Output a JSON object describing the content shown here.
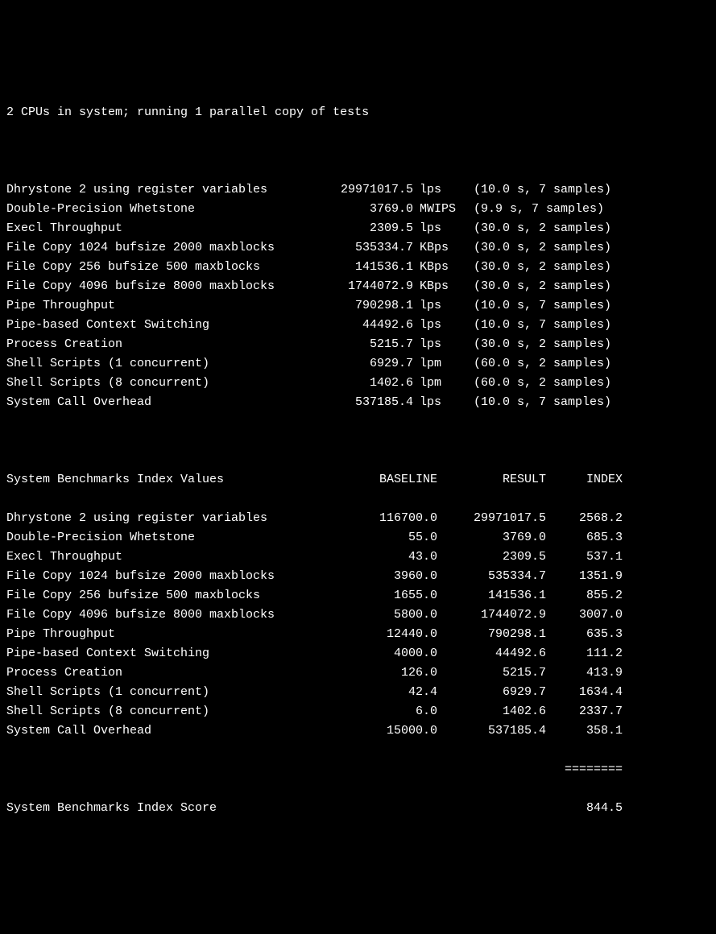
{
  "header": "2 CPUs in system; running 1 parallel copy of tests",
  "tests": [
    {
      "name": "Dhrystone 2 using register variables",
      "value": "29971017.5",
      "unit": "lps",
      "timing": "(10.0 s, 7 samples)"
    },
    {
      "name": "Double-Precision Whetstone",
      "value": "3769.0",
      "unit": "MWIPS",
      "timing": "(9.9 s, 7 samples)"
    },
    {
      "name": "Execl Throughput",
      "value": "2309.5",
      "unit": "lps",
      "timing": "(30.0 s, 2 samples)"
    },
    {
      "name": "File Copy 1024 bufsize 2000 maxblocks",
      "value": "535334.7",
      "unit": "KBps",
      "timing": "(30.0 s, 2 samples)"
    },
    {
      "name": "File Copy 256 bufsize 500 maxblocks",
      "value": "141536.1",
      "unit": "KBps",
      "timing": "(30.0 s, 2 samples)"
    },
    {
      "name": "File Copy 4096 bufsize 8000 maxblocks",
      "value": "1744072.9",
      "unit": "KBps",
      "timing": "(30.0 s, 2 samples)"
    },
    {
      "name": "Pipe Throughput",
      "value": "790298.1",
      "unit": "lps",
      "timing": "(10.0 s, 7 samples)"
    },
    {
      "name": "Pipe-based Context Switching",
      "value": "44492.6",
      "unit": "lps",
      "timing": "(10.0 s, 7 samples)"
    },
    {
      "name": "Process Creation",
      "value": "5215.7",
      "unit": "lps",
      "timing": "(30.0 s, 2 samples)"
    },
    {
      "name": "Shell Scripts (1 concurrent)",
      "value": "6929.7",
      "unit": "lpm",
      "timing": "(60.0 s, 2 samples)"
    },
    {
      "name": "Shell Scripts (8 concurrent)",
      "value": "1402.6",
      "unit": "lpm",
      "timing": "(60.0 s, 2 samples)"
    },
    {
      "name": "System Call Overhead",
      "value": "537185.4",
      "unit": "lps",
      "timing": "(10.0 s, 7 samples)"
    }
  ],
  "index_header": {
    "title": "System Benchmarks Index Values",
    "baseline": "BASELINE",
    "result": "RESULT",
    "index": "INDEX"
  },
  "indexes": [
    {
      "name": "Dhrystone 2 using register variables",
      "baseline": "116700.0",
      "result": "29971017.5",
      "index": "2568.2"
    },
    {
      "name": "Double-Precision Whetstone",
      "baseline": "55.0",
      "result": "3769.0",
      "index": "685.3"
    },
    {
      "name": "Execl Throughput",
      "baseline": "43.0",
      "result": "2309.5",
      "index": "537.1"
    },
    {
      "name": "File Copy 1024 bufsize 2000 maxblocks",
      "baseline": "3960.0",
      "result": "535334.7",
      "index": "1351.9"
    },
    {
      "name": "File Copy 256 bufsize 500 maxblocks",
      "baseline": "1655.0",
      "result": "141536.1",
      "index": "855.2"
    },
    {
      "name": "File Copy 4096 bufsize 8000 maxblocks",
      "baseline": "5800.0",
      "result": "1744072.9",
      "index": "3007.0"
    },
    {
      "name": "Pipe Throughput",
      "baseline": "12440.0",
      "result": "790298.1",
      "index": "635.3"
    },
    {
      "name": "Pipe-based Context Switching",
      "baseline": "4000.0",
      "result": "44492.6",
      "index": "111.2"
    },
    {
      "name": "Process Creation",
      "baseline": "126.0",
      "result": "5215.7",
      "index": "413.9"
    },
    {
      "name": "Shell Scripts (1 concurrent)",
      "baseline": "42.4",
      "result": "6929.7",
      "index": "1634.4"
    },
    {
      "name": "Shell Scripts (8 concurrent)",
      "baseline": "6.0",
      "result": "1402.6",
      "index": "2337.7"
    },
    {
      "name": "System Call Overhead",
      "baseline": "15000.0",
      "result": "537185.4",
      "index": "358.1"
    }
  ],
  "separator": "========",
  "score_label": "System Benchmarks Index Score",
  "score_value": "844.5"
}
